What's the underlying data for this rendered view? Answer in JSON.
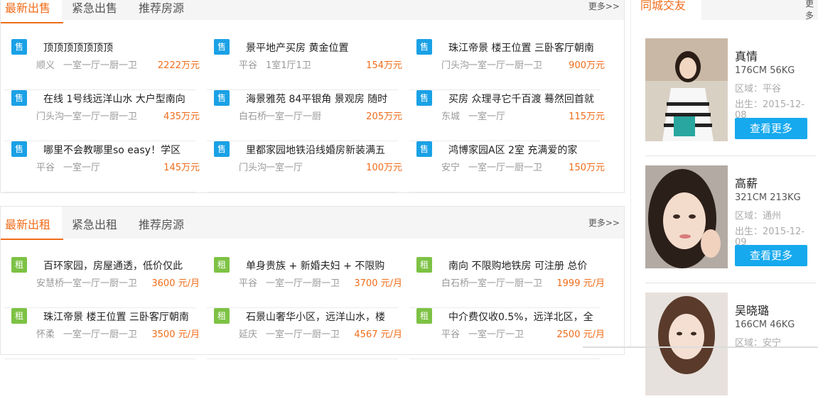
{
  "sale": {
    "tabs": [
      "最新出售",
      "紧急出售",
      "推荐房源"
    ],
    "more": "更多>>",
    "badge": "售",
    "items": [
      {
        "title": "顶顶顶顶顶顶顶",
        "loc": "顺义",
        "layout": "一室一厅一厨一卫",
        "price": "2222万元"
      },
      {
        "title": "景平地产买房 黄金位置",
        "loc": "平谷",
        "layout": "1室1厅1卫",
        "price": "154万元"
      },
      {
        "title": "珠江帝景 楼王位置 三卧客厅朝南",
        "loc": "门头沟",
        "layout": "一室一厅一厨一卫",
        "price": "900万元"
      },
      {
        "title": "在线 1号线远洋山水 大户型南向",
        "loc": "门头沟",
        "layout": "一室一厅一厨一卫",
        "price": "435万元"
      },
      {
        "title": "海景雅苑 84平银角 景观房 随时",
        "loc": "白石桥",
        "layout": "一室一厅一厨",
        "price": "205万元"
      },
      {
        "title": "买房 众理寻它千百渡 蓦然回首就",
        "loc": "东城",
        "layout": "一室一厅",
        "price": "115万元"
      },
      {
        "title": "哪里不会教哪里so easy！学区",
        "loc": "平谷",
        "layout": "一室一厅",
        "price": "145万元"
      },
      {
        "title": "里都家园地铁沿线婚房新装满五",
        "loc": "门头沟",
        "layout": "一室一厅",
        "price": "100万元"
      },
      {
        "title": "鸿博家园A区 2室 充满爱的家",
        "loc": "安宁",
        "layout": "一室一厅一厨一卫",
        "price": "150万元"
      }
    ]
  },
  "rent": {
    "tabs": [
      "最新出租",
      "紧急出租",
      "推荐房源"
    ],
    "more": "更多>>",
    "badge": "租",
    "items": [
      {
        "title": "百环家园，房屋通透，低价仅此",
        "loc": "安慧桥",
        "layout": "一室一厅一厨一卫",
        "price": "3600 元/月"
      },
      {
        "title": "单身贵族 + 新婚夫妇 + 不限购",
        "loc": "平谷",
        "layout": "一室一厅一厨一卫",
        "price": "3700 元/月"
      },
      {
        "title": "南向 不限购地铁房 可注册 总价",
        "loc": "白石桥",
        "layout": "一室一厅一厨一卫",
        "price": "1999 元/月"
      },
      {
        "title": "珠江帝景 楼王位置 三卧客厅朝南",
        "loc": "怀柔",
        "layout": "一室一厅一厨一卫",
        "price": "3500 元/月"
      },
      {
        "title": "石景山奢华小区，远洋山水，楼",
        "loc": "延庆",
        "layout": "一室一厅一厨一卫",
        "price": "4567 元/月"
      },
      {
        "title": "中介费仅收0.5%，远洋北区，全",
        "loc": "平谷",
        "layout": "一室一厅一卫",
        "price": "2500 元/月"
      }
    ]
  },
  "side": {
    "tab": "同城交友",
    "more": "更多",
    "people": [
      {
        "name": "真情",
        "stat": "176CM 56KG",
        "area": "区域：平谷",
        "birth": "出生：2015-12-08",
        "btn": "查看更多"
      },
      {
        "name": "高薪",
        "stat": "321CM 213KG",
        "area": "区域：通州",
        "birth": "出生：2015-12-09",
        "btn": "查看更多"
      },
      {
        "name": "吴晓璐",
        "stat": "166CM 46KG",
        "area": "区域：安宁",
        "birth": "",
        "btn": ""
      }
    ]
  },
  "colors": {
    "accent": "#f06c1a",
    "sale_badge": "#1aa1e6",
    "rent_badge": "#7dc244",
    "button": "#16a9ee"
  }
}
